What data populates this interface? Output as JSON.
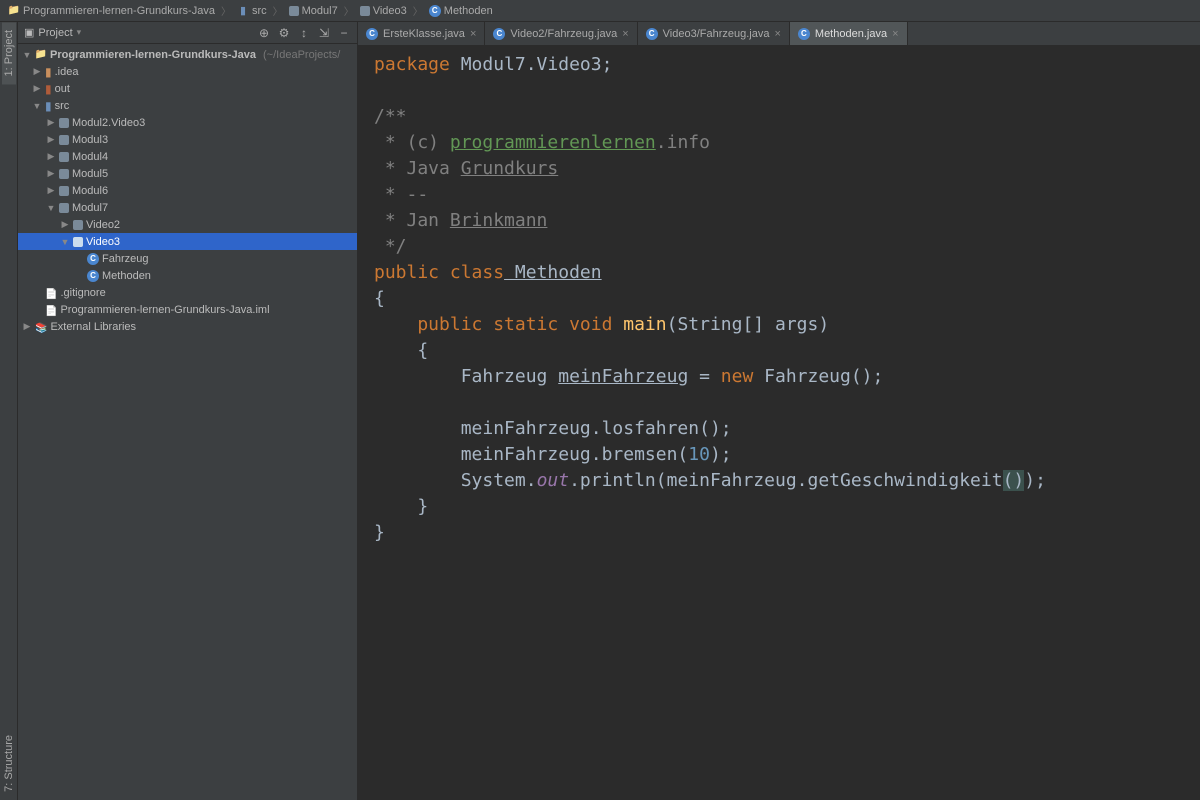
{
  "breadcrumb": [
    {
      "icon": "folder",
      "label": "Programmieren-lernen-Grundkurs-Java"
    },
    {
      "icon": "folder-src",
      "label": "src"
    },
    {
      "icon": "pkg",
      "label": "Modul7"
    },
    {
      "icon": "pkg",
      "label": "Video3"
    },
    {
      "icon": "java",
      "label": "Methoden"
    }
  ],
  "left_gutter": {
    "project_tab": "1: Project",
    "structure_tab": "7: Structure"
  },
  "project_panel": {
    "title_icon": "▣",
    "title": "Project",
    "tool_icons": [
      "⊕",
      "⚙",
      "↕",
      "⇲",
      "−"
    ],
    "root_label": "Programmieren-lernen-Grundkurs-Java",
    "root_path": "(~/IdeaProjects/",
    "items": {
      "idea": ".idea",
      "out": "out",
      "src": "src",
      "mod2": "Modul2.Video3",
      "mod3": "Modul3",
      "mod4": "Modul4",
      "mod5": "Modul5",
      "mod6": "Modul6",
      "mod7": "Modul7",
      "video2": "Video2",
      "video3": "Video3",
      "fahrzeug": "Fahrzeug",
      "methoden": "Methoden",
      "gitignore": ".gitignore",
      "iml": "Programmieren-lernen-Grundkurs-Java.iml",
      "ext": "External Libraries"
    }
  },
  "tabs": [
    {
      "icon": "java",
      "label": "ErsteKlasse.java",
      "active": false
    },
    {
      "icon": "java",
      "label": "Video2/Fahrzeug.java",
      "active": false
    },
    {
      "icon": "java",
      "label": "Video3/Fahrzeug.java",
      "active": false
    },
    {
      "icon": "java",
      "label": "Methoden.java",
      "active": true
    }
  ],
  "code": {
    "l1_kw": "package",
    "l1_rest": " Modul7.Video3;",
    "l3": "/**",
    "l4a": " * (c) ",
    "l4b": "programmierenlernen",
    "l4c": ".info",
    "l5a": " * Java ",
    "l5b": "Grundkurs",
    "l6": " * --",
    "l7a": " * Jan ",
    "l7b": "Brinkmann",
    "l8": " */",
    "l9a": "public",
    "l9b": " class",
    "l9c": " Methoden",
    "l10": "{",
    "l11a": "    public",
    "l11b": " static",
    "l11c": " void",
    "l11d": " main",
    "l11e": "(String[] args)",
    "l12": "    {",
    "l13a": "        Fahrzeug ",
    "l13b": "meinFahrzeug",
    "l13c": " = ",
    "l13d": "new",
    "l13e": " Fahrzeug();",
    "l15": "        meinFahrzeug.losfahren();",
    "l16a": "        meinFahrzeug.bremsen(",
    "l16b": "10",
    "l16c": ");",
    "l17a": "        System.",
    "l17b": "out",
    "l17c": ".println(meinFahrzeug.getGeschwindigkeit",
    "l17d": "()",
    "l17e": ");",
    "l18": "    }",
    "l19": "}"
  }
}
